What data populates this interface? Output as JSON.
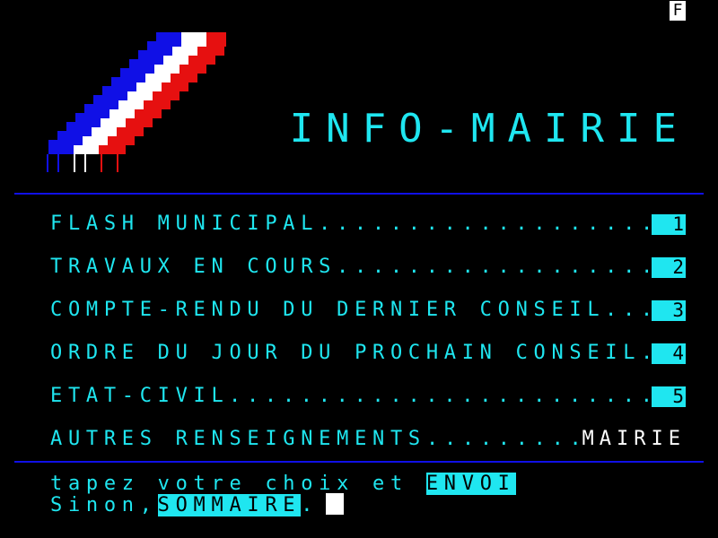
{
  "indicator": "F",
  "title": "INFO-MAIRIE",
  "menu": [
    {
      "label": "FLASH MUNICIPAL",
      "key": "1"
    },
    {
      "label": "TRAVAUX EN COURS",
      "key": "2"
    },
    {
      "label": "COMPTE-RENDU DU DERNIER CONSEIL",
      "key": "3"
    },
    {
      "label": "ORDRE DU JOUR DU PROCHAIN CONSEIL",
      "key": "4"
    },
    {
      "label": "ETAT-CIVIL",
      "key": "5"
    },
    {
      "label": "AUTRES RENSEIGNEMENTS",
      "key": "MAIRIE"
    }
  ],
  "prompt": {
    "line1_text": "tapez votre choix et ",
    "line1_key": "ENVOI",
    "line2_text": "Sinon,",
    "line2_key": "SOMMAIRE",
    "line2_end": "."
  },
  "colors": {
    "text": "#1fe6f0",
    "rule": "#1010e6",
    "flag_blue": "#1010e6",
    "flag_white": "#ffffff",
    "flag_red": "#e61010",
    "background": "#000000"
  },
  "icons": {
    "flag": "tricolor-flag-icon"
  }
}
